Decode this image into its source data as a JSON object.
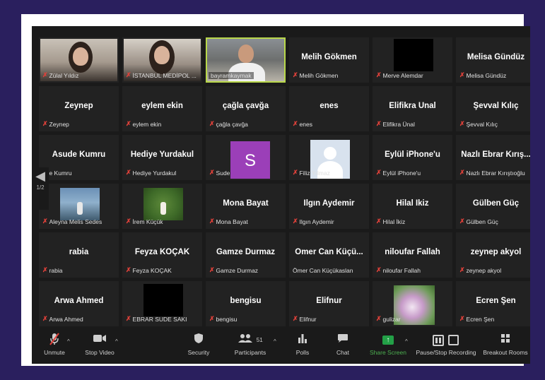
{
  "participants": [
    {
      "big": "",
      "small": "Zülal Yıldız",
      "muted": true
    },
    {
      "big": "",
      "small": "İSTANBUL MEDİPOL ...",
      "muted": true
    },
    {
      "big": "",
      "small": "bayramkaymak",
      "muted": false
    },
    {
      "big": "Melih Gökmen",
      "small": "Melih Gökmen",
      "muted": true
    },
    {
      "big": "",
      "small": "Merve Alemdar",
      "muted": true
    },
    {
      "big": "Melisa Gündüz",
      "small": "Melisa Gündüz",
      "muted": true
    },
    {
      "big": "Zeynep",
      "small": "Zeynep",
      "muted": true
    },
    {
      "big": "eylem ekin",
      "small": "eylem ekin",
      "muted": true
    },
    {
      "big": "çağla çavğa",
      "small": "çağla çavğa",
      "muted": true
    },
    {
      "big": "enes",
      "small": "enes",
      "muted": true
    },
    {
      "big": "Elifikra Ünal",
      "small": "Elifikra Ünal",
      "muted": true
    },
    {
      "big": "Şevval Kılıç",
      "small": "Şevval Kılıç",
      "muted": true
    },
    {
      "big": "Asude Kumru",
      "small": "ude Kumru",
      "muted": false
    },
    {
      "big": "Hediye Yurdakul",
      "small": "Hediye Yurdakul",
      "muted": true
    },
    {
      "big": "",
      "small": "Sude",
      "muted": true,
      "avatar_letter": "S",
      "avatar_color": "#9b3fb8"
    },
    {
      "big": "",
      "small": "Filiz Yılmaz",
      "muted": true
    },
    {
      "big": "Eylül iPhone'u",
      "small": "Eylül iPhone'u",
      "muted": true
    },
    {
      "big": "Nazlı Ebrar Kırış...",
      "small": "Nazlı Ebrar Kırıştıoğlu",
      "muted": true
    },
    {
      "big": "",
      "small": "Aleyna Melis Sedes",
      "muted": true
    },
    {
      "big": "",
      "small": "İrem Küçük",
      "muted": true
    },
    {
      "big": "Mona Bayat",
      "small": "Mona Bayat",
      "muted": true
    },
    {
      "big": "Ilgın Aydemir",
      "small": "Ilgın Aydemir",
      "muted": true
    },
    {
      "big": "Hilal İkiz",
      "small": "Hilal İkiz",
      "muted": true
    },
    {
      "big": "Gülben Güç",
      "small": "Gülben Güç",
      "muted": true
    },
    {
      "big": "rabia",
      "small": "rabia",
      "muted": true
    },
    {
      "big": "Feyza KOÇAK",
      "small": "Feyza KOÇAK",
      "muted": true
    },
    {
      "big": "Gamze Durmaz",
      "small": "Gamze Durmaz",
      "muted": true
    },
    {
      "big": "Ömer Can Küçü...",
      "small": "Ömer Can Küçükaslan",
      "muted": false
    },
    {
      "big": "niloufar Fallah",
      "small": "niloufar Fallah",
      "muted": true
    },
    {
      "big": "zeynep akyol",
      "small": "zeynep akyol",
      "muted": true
    },
    {
      "big": "Arwa Ahmed",
      "small": "Arwa Ahmed",
      "muted": true
    },
    {
      "big": "",
      "small": "EBRAR SUDE SAKI",
      "muted": true
    },
    {
      "big": "bengisu",
      "small": "bengisu",
      "muted": true
    },
    {
      "big": "Elifnur",
      "small": "Elifnur",
      "muted": true
    },
    {
      "big": "",
      "small": "gulizar",
      "muted": true
    },
    {
      "big": "Ecren Şen",
      "small": "Ecren Şen",
      "muted": true
    }
  ],
  "pager": {
    "label": "1/2"
  },
  "toolbar": {
    "unmute": "Unmute",
    "stop_video": "Stop Video",
    "security": "Security",
    "participants": "Participants",
    "participants_count": "51",
    "polls": "Polls",
    "chat": "Chat",
    "share_screen": "Share Screen",
    "recording": "Pause/Stop Recording",
    "breakout": "Breakout Rooms"
  },
  "colors": {
    "active_speaker": "#b9d84a",
    "share_green": "#23a047",
    "mute_red": "#e0413a"
  }
}
